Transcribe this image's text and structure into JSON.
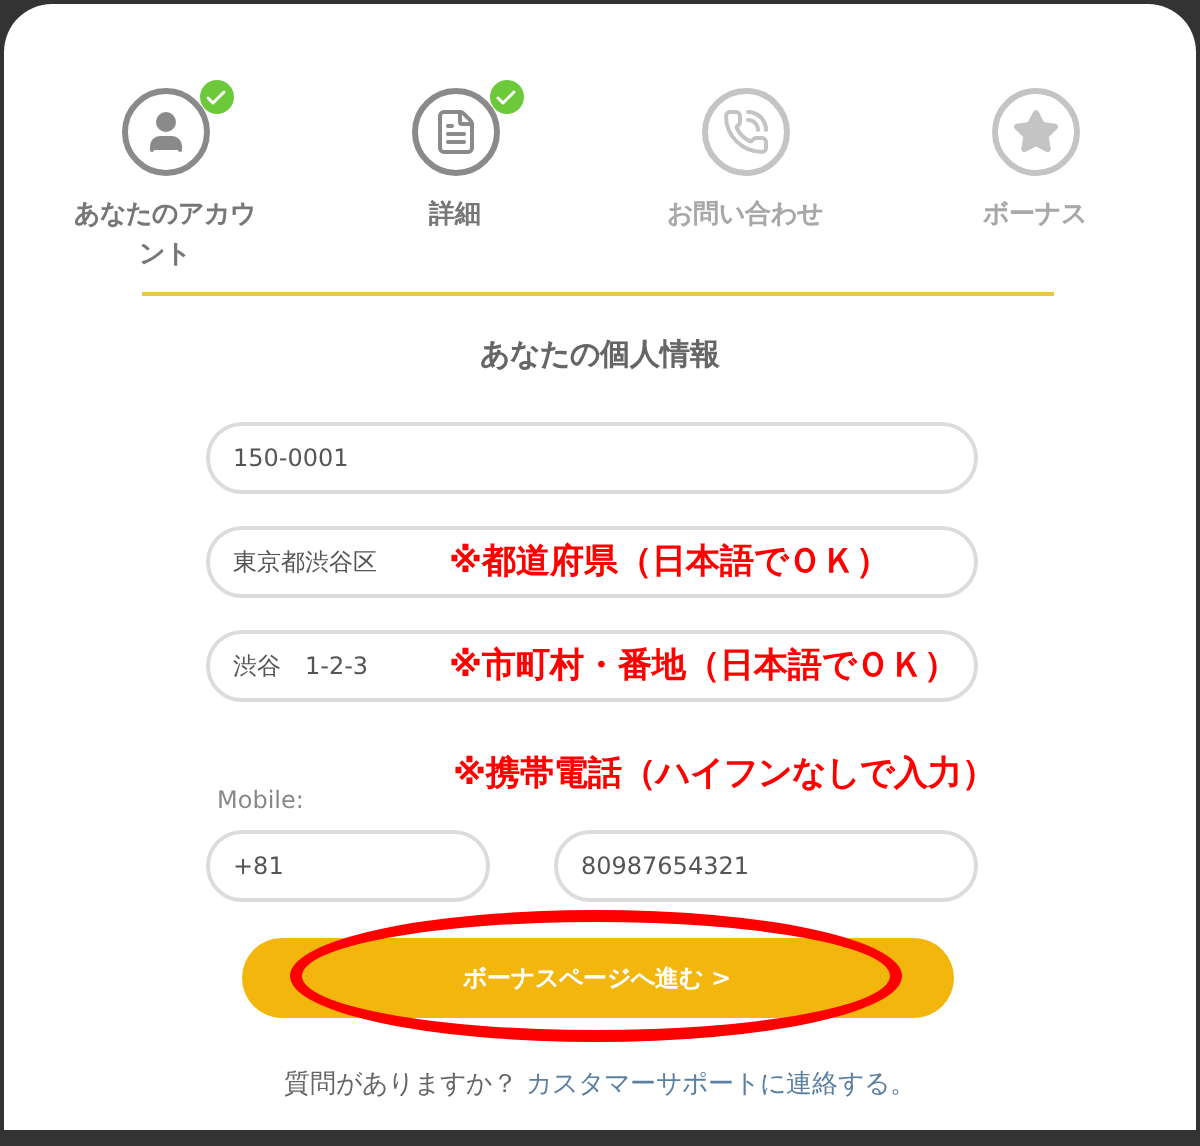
{
  "steps": [
    {
      "label": "あなたのアカウント",
      "kind": "account",
      "completed": true
    },
    {
      "label": "詳細",
      "kind": "details",
      "completed": true
    },
    {
      "label": "お問い合わせ",
      "kind": "contact",
      "completed": false
    },
    {
      "label": "ボーナス",
      "kind": "bonus",
      "completed": false
    }
  ],
  "title": "あなたの個人情報",
  "fields": [
    {
      "value": "150-0001"
    },
    {
      "value": "東京都渋谷区",
      "note": "※都道府県（日本語でＯＫ）"
    },
    {
      "value": "渋谷　1-2-3",
      "note": "※市町村・番地（日本語でＯＫ）"
    }
  ],
  "mobile": {
    "label": "Mobile:",
    "note": "※携帯電話（ハイフンなしで入力）",
    "code": "+81",
    "number": "80987654321"
  },
  "submit": {
    "label": "ボーナスページへ進む >",
    "highlighted": true
  },
  "help": {
    "text": "質問がありますか？",
    "link": "カスタマーサポートに連絡する。"
  }
}
